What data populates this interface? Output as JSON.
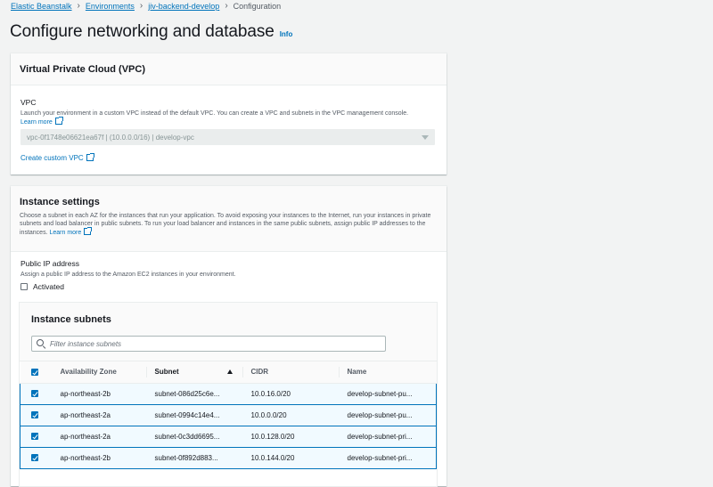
{
  "breadcrumb": {
    "items": [
      "Elastic Beanstalk",
      "Environments",
      "jiv-backend-develop"
    ],
    "current": "Configuration"
  },
  "page": {
    "title": "Configure networking and database",
    "info": "Info"
  },
  "vpc_panel": {
    "title": "Virtual Private Cloud (VPC)",
    "vpc_label": "VPC",
    "vpc_description": "Launch your environment in a custom VPC instead of the default VPC. You can create a VPC and subnets in the VPC management console.",
    "learn_more": "Learn more",
    "selected_vpc": "vpc-0f1748e06621ea67f | (10.0.0.0/16) | develop-vpc",
    "create_custom_vpc": "Create custom VPC"
  },
  "instance_panel": {
    "title": "Instance settings",
    "description": "Choose a subnet in each AZ for the instances that run your application. To avoid exposing your instances to the Internet, run your instances in private subnets and load balancer in public subnets. To run your load balancer and instances in the same public subnets, assign public IP addresses to the instances.",
    "learn_more": "Learn more",
    "public_ip_label": "Public IP address",
    "public_ip_description": "Assign a public IP address to the Amazon EC2 instances in your environment.",
    "activated_label": "Activated",
    "activated_checked": false
  },
  "subnets": {
    "title": "Instance subnets",
    "filter_placeholder": "Filter instance subnets",
    "columns": [
      "Availability Zone",
      "Subnet",
      "CIDR",
      "Name"
    ],
    "rows": [
      {
        "az": "ap-northeast-2b",
        "subnet": "subnet-086d25c6e...",
        "cidr": "10.0.16.0/20",
        "name": "develop-subnet-pu...",
        "checked": true
      },
      {
        "az": "ap-northeast-2a",
        "subnet": "subnet-0994c14e4...",
        "cidr": "10.0.0.0/20",
        "name": "develop-subnet-pu...",
        "checked": true
      },
      {
        "az": "ap-northeast-2a",
        "subnet": "subnet-0c3dd6695...",
        "cidr": "10.0.128.0/20",
        "name": "develop-subnet-pri...",
        "checked": true
      },
      {
        "az": "ap-northeast-2b",
        "subnet": "subnet-0f892d883...",
        "cidr": "10.0.144.0/20",
        "name": "develop-subnet-pri...",
        "checked": true
      }
    ]
  },
  "colors": {
    "accent": "#0073bb",
    "background": "#f2f3f3",
    "selected_row": "#f1faff"
  }
}
